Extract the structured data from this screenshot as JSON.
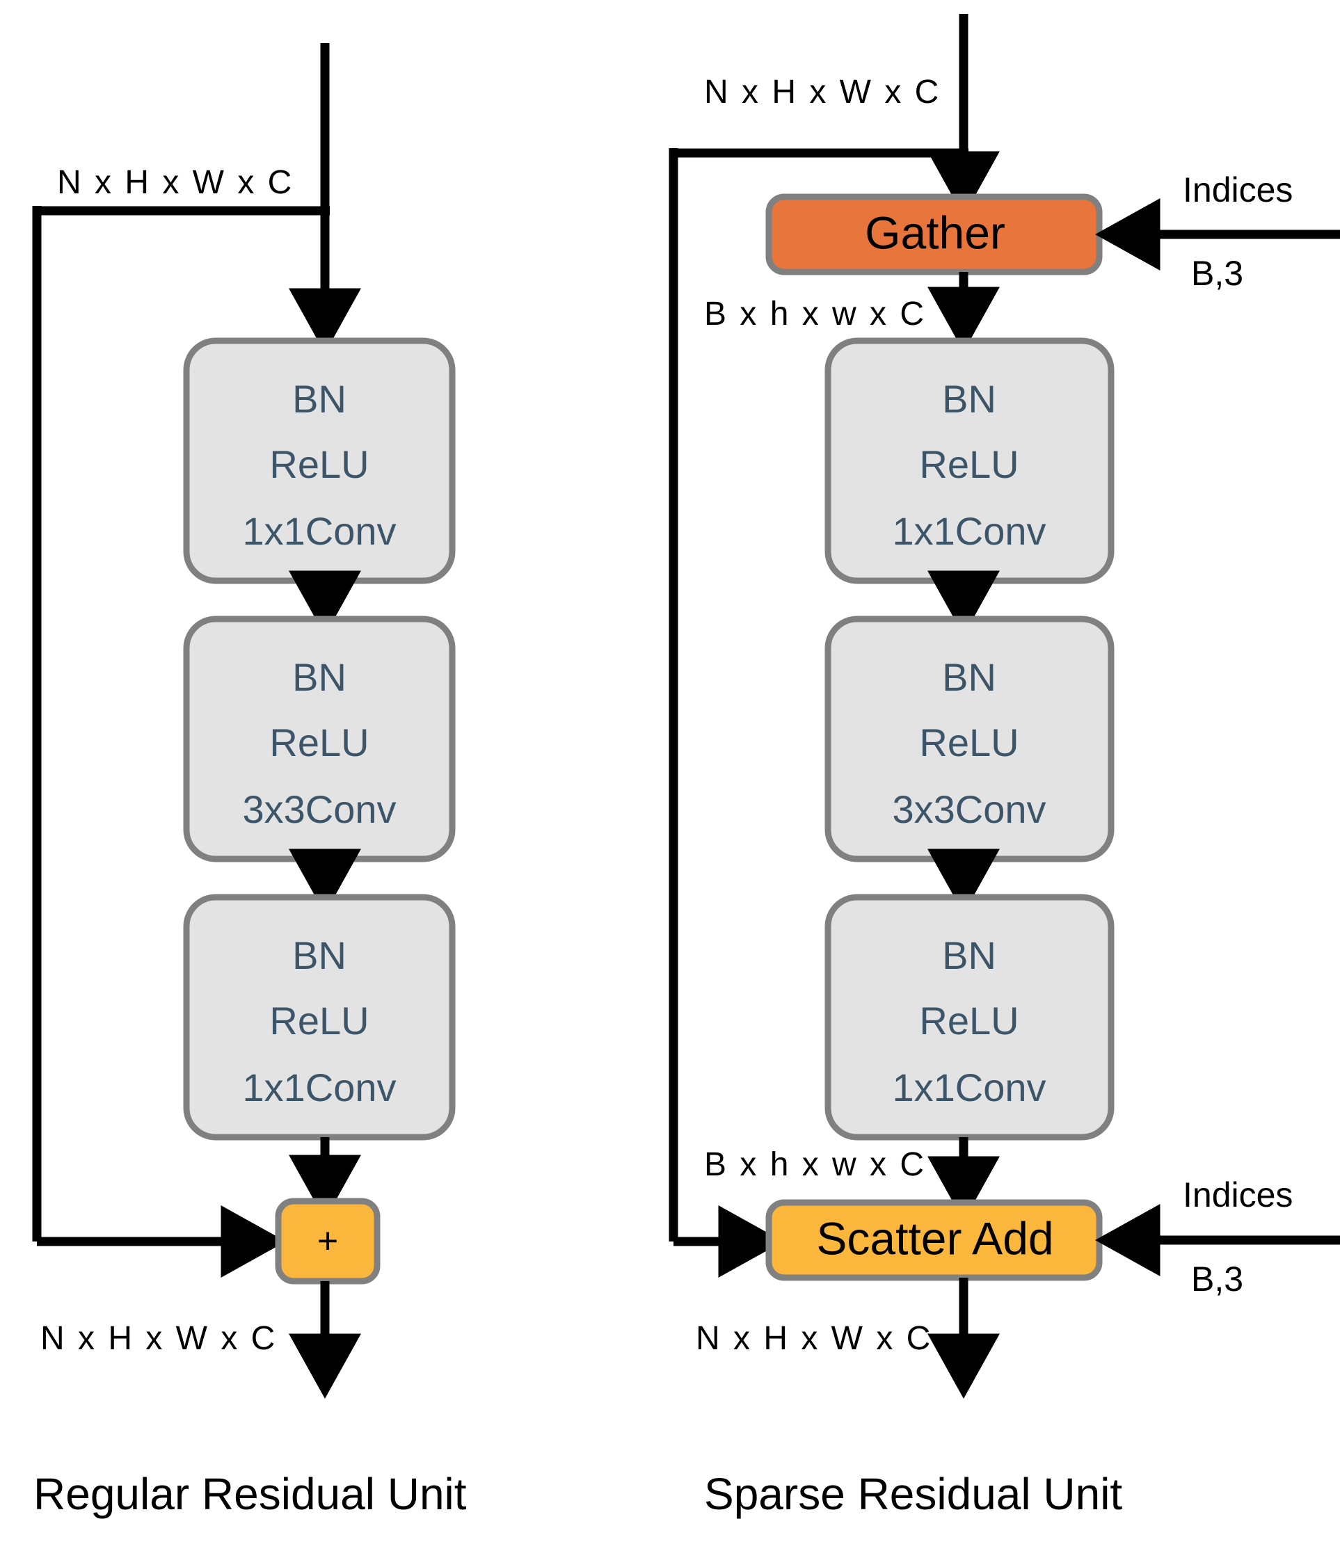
{
  "figure": {
    "background": "#ffffff",
    "panels": [
      {
        "id": "regular",
        "caption": "Regular Residual Unit",
        "input_label": "N x H x W x C",
        "output_label": "N x H x W x C",
        "blocks": [
          {
            "lines": [
              "BN",
              "ReLU",
              "1x1Conv"
            ]
          },
          {
            "lines": [
              "BN",
              "ReLU",
              "3x3Conv"
            ]
          },
          {
            "lines": [
              "BN",
              "ReLU",
              "1x1Conv"
            ]
          }
        ],
        "merge_op": {
          "label": "+",
          "color": "#fbb73c"
        }
      },
      {
        "id": "sparse",
        "caption": "Sparse Residual Unit",
        "input_label": "N x H x W x C",
        "output_label": "N x H x W x C",
        "gather": {
          "label": "Gather",
          "color": "#e8763c",
          "side_input_label": "Indices",
          "side_input_shape": "B,3",
          "output_label": "B x h x w x C"
        },
        "blocks": [
          {
            "lines": [
              "BN",
              "ReLU",
              "1x1Conv"
            ]
          },
          {
            "lines": [
              "BN",
              "ReLU",
              "3x3Conv"
            ]
          },
          {
            "lines": [
              "BN",
              "ReLU",
              "1x1Conv"
            ]
          }
        ],
        "scatter": {
          "label": "Scatter Add",
          "color": "#fbb73c",
          "side_input_label": "Indices",
          "side_input_shape": "B,3",
          "input_label": "B x h x w x C"
        }
      }
    ],
    "colors": {
      "block_fill": "#e3e3e3",
      "block_stroke": "#808080",
      "block_text": "#3d5568",
      "arrow": "#000000",
      "gather": "#e8763c",
      "scatter": "#fbb73c",
      "plus": "#fbb73c"
    }
  }
}
